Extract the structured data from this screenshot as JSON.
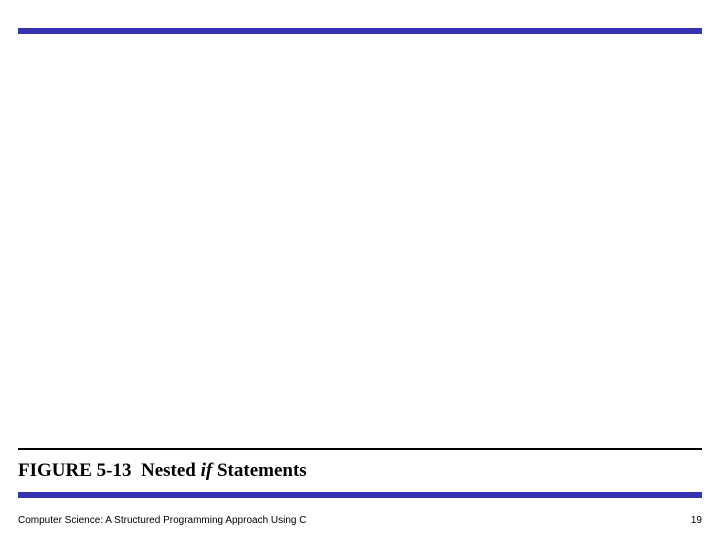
{
  "caption": {
    "figure_label": "FIGURE 5-13",
    "spacer": "  ",
    "title_prefix": "Nested ",
    "title_italic": "if",
    "title_suffix": " Statements"
  },
  "footer": {
    "book_title": "Computer Science: A Structured Programming Approach Using C",
    "page_number": "19"
  }
}
